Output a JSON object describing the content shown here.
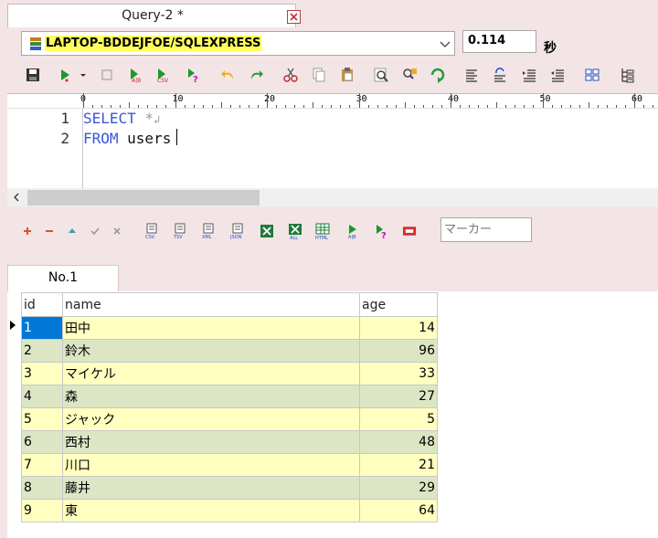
{
  "window": {
    "tab_title": "Query-2 *"
  },
  "connection": {
    "server": "LAPTOP-BDDEJFOE/SQLEXPRESS",
    "elapsed_value": "0.114",
    "elapsed_unit": "秒"
  },
  "ruler": {
    "marks": [
      "0",
      "10",
      "20",
      "30",
      "40",
      "50",
      "60"
    ]
  },
  "editor": {
    "lines": [
      {
        "num": "1",
        "keyword": "SELECT",
        "rest": " *",
        "newline_mark": "↲"
      },
      {
        "num": "2",
        "keyword": "FROM",
        "rest": " users",
        "newline_mark": ""
      }
    ]
  },
  "result_toolbar": {
    "marker_placeholder": "マーカー"
  },
  "result_tabs": [
    {
      "label": "No.1"
    }
  ],
  "grid": {
    "columns": [
      "id",
      "name",
      "age"
    ],
    "rows": [
      [
        "1",
        "田中",
        "14"
      ],
      [
        "2",
        "鈴木",
        "96"
      ],
      [
        "3",
        "マイケル",
        "33"
      ],
      [
        "4",
        "森",
        "27"
      ],
      [
        "5",
        "ジャック",
        "5"
      ],
      [
        "6",
        "西村",
        "48"
      ],
      [
        "7",
        "川口",
        "21"
      ],
      [
        "8",
        "藤井",
        "29"
      ],
      [
        "9",
        "東",
        "64"
      ]
    ]
  },
  "icons": {
    "toolbar": [
      "save-icon",
      "run-icon",
      "run-dropdown-icon",
      "stop-icon",
      "export-ab-icon",
      "export-csv-icon",
      "explain-icon",
      "undo-icon",
      "redo-icon",
      "cut-icon",
      "copy-icon",
      "paste-icon",
      "find-icon",
      "replace-icon",
      "refresh-icon",
      "align-left-icon",
      "format-icon",
      "indent-icon",
      "outdent-icon",
      "compare-icon",
      "tree-icon"
    ],
    "result_toolbar": [
      "add-row-icon",
      "delete-row-icon",
      "move-up-icon",
      "commit-icon",
      "cancel-icon",
      "export-csv-icon",
      "export-tsv-icon",
      "export-xml-icon",
      "export-json-icon",
      "export-excel-icon",
      "export-excel-all-icon",
      "export-html-icon",
      "export-ab-icon",
      "explain-icon",
      "record-icon"
    ]
  },
  "colors": {
    "background": "#f3e4e6",
    "keyword": "#3a55d8",
    "row_odd": "#ffffc0",
    "row_even": "#dce6c4",
    "selection": "#0078d7",
    "highlight": "#ffff5e"
  }
}
